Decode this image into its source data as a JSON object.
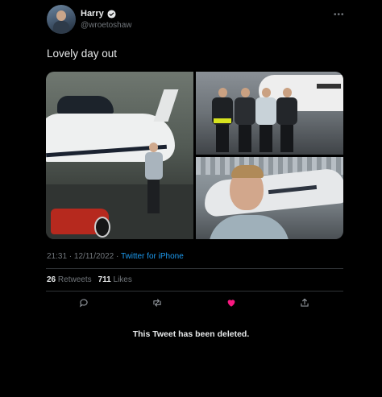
{
  "author": {
    "display_name": "Harry",
    "handle": "@wroetoshaw"
  },
  "tweet": {
    "text": "Lovely day out",
    "time": "21:31 · 12/11/2022 · ",
    "source": "Twitter for iPhone"
  },
  "stats": {
    "retweets_count": "26",
    "retweets_label": "Retweets",
    "likes_count": "711",
    "likes_label": "Likes"
  },
  "actions": [
    "reply-icon",
    "retweet-icon",
    "like-icon",
    "share-icon"
  ],
  "colors": {
    "background": "#000000",
    "text": "#e7e9ea",
    "secondary": "#71767b",
    "link": "#1d9bf0",
    "like": "#f91880"
  },
  "notice": "This Tweet has been deleted."
}
